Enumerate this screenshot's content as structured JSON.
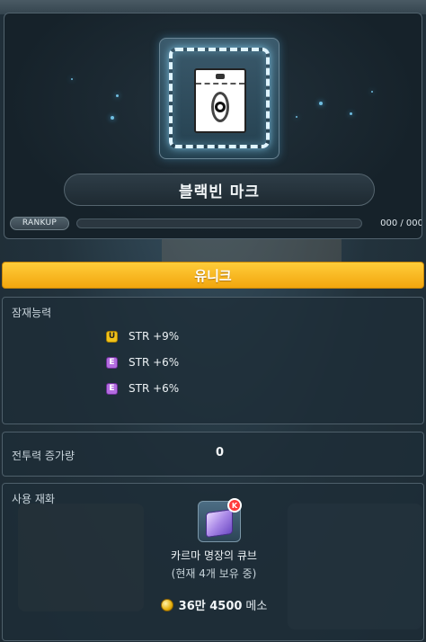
{
  "item": {
    "name": "블랙빈 마크",
    "rank_label": "RANKUP",
    "rank_value": "000 / 000",
    "rank_progress": 0
  },
  "grade": {
    "label": "유니크",
    "color": "#f5b320"
  },
  "potential": {
    "title": "잠재능력",
    "lines": [
      {
        "badge": "U",
        "text": "STR +9%"
      },
      {
        "badge": "E",
        "text": "STR +6%"
      },
      {
        "badge": "E",
        "text": "STR +6%"
      }
    ]
  },
  "combat": {
    "title": "전투력 증가량",
    "value": "0"
  },
  "material": {
    "title": "사용 재화",
    "icon": "cube-icon",
    "badge": "K",
    "name": "카르마 명장의 큐브",
    "owned": "(현재 4개 보유 중)",
    "cost_amount": "36만 4500",
    "cost_unit": "메소"
  },
  "colors": {
    "unique": "#f1c21a",
    "epic": "#b36be0",
    "glow": "#dff4ff"
  }
}
